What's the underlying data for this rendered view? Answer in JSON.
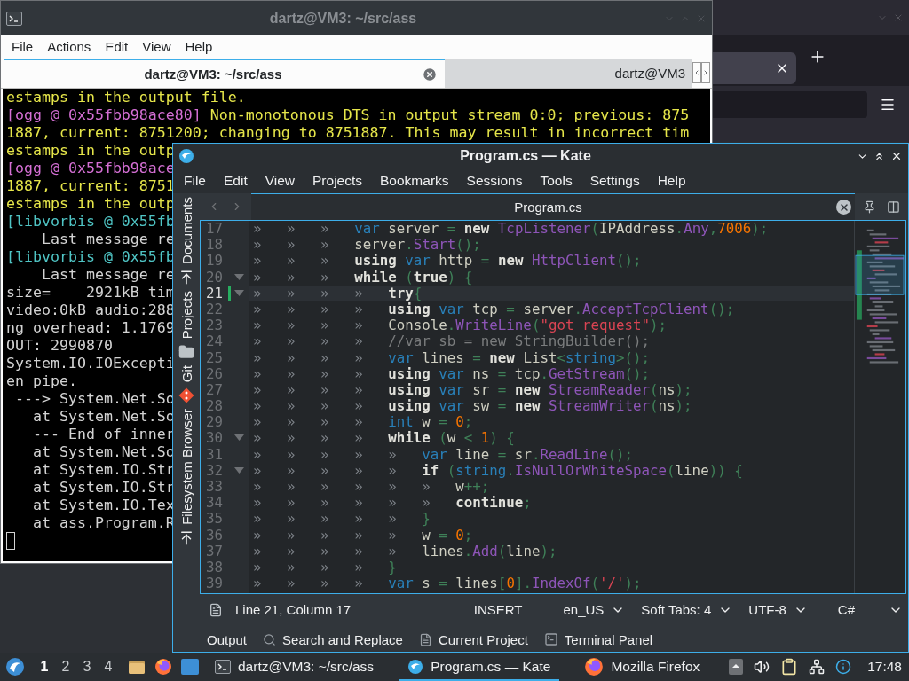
{
  "terminal": {
    "title": "dartz@VM3: ~/src/ass",
    "menu": [
      "File",
      "Actions",
      "Edit",
      "View",
      "Help"
    ],
    "tabs": [
      {
        "label": "dartz@VM3: ~/src/ass",
        "selected": true
      },
      {
        "label": "dartz@VM3",
        "selected": false
      }
    ],
    "lines": [
      {
        "segments": [
          {
            "text": "estamps in the output file.",
            "color": "#e6e64a"
          }
        ]
      },
      {
        "segments": [
          {
            "text": "[ogg @ 0x55fbb98ace80]",
            "color": "#d46fd4"
          },
          {
            "text": " Non-monotonous DTS in output stream 0:0; previous: 875",
            "color": "#e6e64a"
          }
        ]
      },
      {
        "segments": [
          {
            "text": "1887, current: 8751200; changing to 8751887. This may result in incorrect tim",
            "color": "#e6e64a"
          }
        ]
      },
      {
        "segments": [
          {
            "text": "estamps in the outp",
            "color": "#e6e64a"
          }
        ]
      },
      {
        "segments": [
          {
            "text": "[ogg @ 0x55fbb98ace",
            "color": "#d46fd4"
          }
        ]
      },
      {
        "segments": [
          {
            "text": "1887, current: 8751",
            "color": "#e6e64a"
          }
        ]
      },
      {
        "segments": [
          {
            "text": "estamps in the outp",
            "color": "#e6e64a"
          }
        ]
      },
      {
        "segments": [
          {
            "text": "[libvorbis @ 0x55fb",
            "color": "#4fc4c4"
          }
        ]
      },
      {
        "segments": [
          {
            "text": "    Last message re",
            "color": "#d3d3d3"
          }
        ]
      },
      {
        "segments": [
          {
            "text": "[libvorbis @ 0x55fb",
            "color": "#4fc4c4"
          }
        ]
      },
      {
        "segments": [
          {
            "text": "    Last message re",
            "color": "#d3d3d3"
          }
        ]
      },
      {
        "segments": [
          {
            "text": "size=    2921kB tim",
            "color": "#d3d3d3"
          }
        ]
      },
      {
        "segments": [
          {
            "text": "video:0kB audio:288",
            "color": "#d3d3d3"
          }
        ]
      },
      {
        "segments": [
          {
            "text": "ng overhead: 1.1769",
            "color": "#d3d3d3"
          }
        ]
      },
      {
        "segments": [
          {
            "text": "OUT: 2990870",
            "color": "#d3d3d3"
          }
        ]
      },
      {
        "segments": [
          {
            "text": "System.IO.IOExcepti",
            "color": "#d3d3d3"
          }
        ]
      },
      {
        "segments": [
          {
            "text": "en pipe.",
            "color": "#d3d3d3"
          }
        ]
      },
      {
        "segments": [
          {
            "text": " ---> System.Net.So",
            "color": "#d3d3d3"
          }
        ]
      },
      {
        "segments": [
          {
            "text": "   at System.Net.So",
            "color": "#d3d3d3"
          }
        ]
      },
      {
        "segments": [
          {
            "text": "   --- End of inner",
            "color": "#d3d3d3"
          }
        ]
      },
      {
        "segments": [
          {
            "text": "   at System.Net.So",
            "color": "#d3d3d3"
          }
        ]
      },
      {
        "segments": [
          {
            "text": "   at System.IO.Str",
            "color": "#d3d3d3"
          }
        ]
      },
      {
        "segments": [
          {
            "text": "   at System.IO.Str",
            "color": "#d3d3d3"
          }
        ]
      },
      {
        "segments": [
          {
            "text": "   at System.IO.Tex",
            "color": "#d3d3d3"
          }
        ]
      },
      {
        "segments": [
          {
            "text": "   at ass.Program.R",
            "color": "#d3d3d3"
          }
        ]
      }
    ]
  },
  "kate": {
    "title": "Program.cs — Kate",
    "menu": [
      "File",
      "Edit",
      "View",
      "Projects",
      "Bookmarks",
      "Sessions",
      "Tools",
      "Settings",
      "Help"
    ],
    "sidebar": [
      {
        "label": "Documents",
        "kind": "documents"
      },
      {
        "label": "Projects",
        "kind": "projects"
      },
      {
        "label": "Git",
        "kind": "git"
      },
      {
        "label": "Filesystem Browser",
        "kind": "files"
      }
    ],
    "tab": {
      "label": "Program.cs"
    },
    "editor": {
      "lines": [
        {
          "number": "17",
          "indent": "»»»",
          "fold": false,
          "modified": false,
          "current": false,
          "tokens": [
            {
              "kind": "type",
              "text": "var"
            },
            {
              "kind": "plain",
              "text": " server "
            },
            {
              "kind": "operator",
              "text": "= "
            },
            {
              "kind": "keyword",
              "text": "new "
            },
            {
              "kind": "function",
              "text": "TcpListener"
            },
            {
              "kind": "operator",
              "text": "("
            },
            {
              "kind": "plain",
              "text": "IPAddress"
            },
            {
              "kind": "operator",
              "text": "."
            },
            {
              "kind": "function",
              "text": "Any"
            },
            {
              "kind": "operator",
              "text": ","
            },
            {
              "kind": "number",
              "text": "7006"
            },
            {
              "kind": "operator",
              "text": ");"
            }
          ]
        },
        {
          "number": "18",
          "indent": "»»»",
          "fold": false,
          "modified": false,
          "current": false,
          "tokens": [
            {
              "kind": "plain",
              "text": "server"
            },
            {
              "kind": "operator",
              "text": "."
            },
            {
              "kind": "function",
              "text": "Start"
            },
            {
              "kind": "operator",
              "text": "();"
            }
          ]
        },
        {
          "number": "19",
          "indent": "»»»",
          "fold": false,
          "modified": false,
          "current": false,
          "tokens": [
            {
              "kind": "keyword",
              "text": "using "
            },
            {
              "kind": "type",
              "text": "var"
            },
            {
              "kind": "plain",
              "text": " http "
            },
            {
              "kind": "operator",
              "text": "= "
            },
            {
              "kind": "keyword",
              "text": "new "
            },
            {
              "kind": "function",
              "text": "HttpClient"
            },
            {
              "kind": "operator",
              "text": "();"
            }
          ]
        },
        {
          "number": "20",
          "indent": "»»»",
          "fold": true,
          "modified": false,
          "current": false,
          "tokens": [
            {
              "kind": "keyword",
              "text": "while "
            },
            {
              "kind": "operator",
              "text": "("
            },
            {
              "kind": "keyword",
              "text": "true"
            },
            {
              "kind": "operator",
              "text": ") {"
            }
          ]
        },
        {
          "number": "21",
          "indent": "»»»»",
          "fold": true,
          "modified": true,
          "current": true,
          "tokens": [
            {
              "kind": "keyword",
              "text": "try"
            },
            {
              "kind": "operator",
              "text": "{"
            }
          ]
        },
        {
          "number": "22",
          "indent": "»»»»",
          "fold": false,
          "modified": false,
          "current": false,
          "tokens": [
            {
              "kind": "keyword",
              "text": "using "
            },
            {
              "kind": "type",
              "text": "var"
            },
            {
              "kind": "plain",
              "text": " tcp "
            },
            {
              "kind": "operator",
              "text": "="
            },
            {
              "kind": "plain",
              "text": " server"
            },
            {
              "kind": "operator",
              "text": "."
            },
            {
              "kind": "function",
              "text": "AcceptTcpClient"
            },
            {
              "kind": "operator",
              "text": "();"
            }
          ]
        },
        {
          "number": "23",
          "indent": "»»»»",
          "fold": false,
          "modified": false,
          "current": false,
          "tokens": [
            {
              "kind": "plain",
              "text": "Console"
            },
            {
              "kind": "operator",
              "text": "."
            },
            {
              "kind": "function",
              "text": "WriteLine"
            },
            {
              "kind": "operator",
              "text": "("
            },
            {
              "kind": "string",
              "text": "\"got request\""
            },
            {
              "kind": "operator",
              "text": ");"
            }
          ]
        },
        {
          "number": "24",
          "indent": "»»»»",
          "fold": false,
          "modified": false,
          "current": false,
          "tokens": [
            {
              "kind": "comment",
              "text": "//var sb = new StringBuilder();"
            }
          ]
        },
        {
          "number": "25",
          "indent": "»»»»",
          "fold": false,
          "modified": false,
          "current": false,
          "tokens": [
            {
              "kind": "type",
              "text": "var"
            },
            {
              "kind": "plain",
              "text": " lines "
            },
            {
              "kind": "operator",
              "text": "= "
            },
            {
              "kind": "keyword",
              "text": "new"
            },
            {
              "kind": "plain",
              "text": " List"
            },
            {
              "kind": "operator",
              "text": "<"
            },
            {
              "kind": "type",
              "text": "string"
            },
            {
              "kind": "operator",
              "text": ">();"
            }
          ]
        },
        {
          "number": "26",
          "indent": "»»»»",
          "fold": false,
          "modified": false,
          "current": false,
          "tokens": [
            {
              "kind": "keyword",
              "text": "using "
            },
            {
              "kind": "type",
              "text": "var"
            },
            {
              "kind": "plain",
              "text": " ns "
            },
            {
              "kind": "operator",
              "text": "="
            },
            {
              "kind": "plain",
              "text": " tcp"
            },
            {
              "kind": "operator",
              "text": "."
            },
            {
              "kind": "function",
              "text": "GetStream"
            },
            {
              "kind": "operator",
              "text": "();"
            }
          ]
        },
        {
          "number": "27",
          "indent": "»»»»",
          "fold": false,
          "modified": false,
          "current": false,
          "tokens": [
            {
              "kind": "keyword",
              "text": "using "
            },
            {
              "kind": "type",
              "text": "var"
            },
            {
              "kind": "plain",
              "text": " sr "
            },
            {
              "kind": "operator",
              "text": "= "
            },
            {
              "kind": "keyword",
              "text": "new "
            },
            {
              "kind": "function",
              "text": "StreamReader"
            },
            {
              "kind": "operator",
              "text": "("
            },
            {
              "kind": "plain",
              "text": "ns"
            },
            {
              "kind": "operator",
              "text": ");"
            }
          ]
        },
        {
          "number": "28",
          "indent": "»»»»",
          "fold": false,
          "modified": false,
          "current": false,
          "tokens": [
            {
              "kind": "keyword",
              "text": "using "
            },
            {
              "kind": "type",
              "text": "var"
            },
            {
              "kind": "plain",
              "text": " sw "
            },
            {
              "kind": "operator",
              "text": "= "
            },
            {
              "kind": "keyword",
              "text": "new "
            },
            {
              "kind": "function",
              "text": "StreamWriter"
            },
            {
              "kind": "operator",
              "text": "("
            },
            {
              "kind": "plain",
              "text": "ns"
            },
            {
              "kind": "operator",
              "text": ");"
            }
          ]
        },
        {
          "number": "29",
          "indent": "»»»»",
          "fold": false,
          "modified": false,
          "current": false,
          "tokens": [
            {
              "kind": "type",
              "text": "int"
            },
            {
              "kind": "plain",
              "text": " w "
            },
            {
              "kind": "operator",
              "text": "= "
            },
            {
              "kind": "number",
              "text": "0"
            },
            {
              "kind": "operator",
              "text": ";"
            }
          ]
        },
        {
          "number": "30",
          "indent": "»»»»",
          "fold": true,
          "modified": false,
          "current": false,
          "tokens": [
            {
              "kind": "keyword",
              "text": "while "
            },
            {
              "kind": "operator",
              "text": "("
            },
            {
              "kind": "plain",
              "text": "w "
            },
            {
              "kind": "operator",
              "text": "< "
            },
            {
              "kind": "number",
              "text": "1"
            },
            {
              "kind": "operator",
              "text": ") {"
            }
          ]
        },
        {
          "number": "31",
          "indent": "»»»»»",
          "fold": false,
          "modified": false,
          "current": false,
          "tokens": [
            {
              "kind": "type",
              "text": "var"
            },
            {
              "kind": "plain",
              "text": " line "
            },
            {
              "kind": "operator",
              "text": "="
            },
            {
              "kind": "plain",
              "text": " sr"
            },
            {
              "kind": "operator",
              "text": "."
            },
            {
              "kind": "function",
              "text": "ReadLine"
            },
            {
              "kind": "operator",
              "text": "();"
            }
          ]
        },
        {
          "number": "32",
          "indent": "»»»»»",
          "fold": true,
          "modified": false,
          "current": false,
          "tokens": [
            {
              "kind": "keyword",
              "text": "if "
            },
            {
              "kind": "operator",
              "text": "("
            },
            {
              "kind": "type",
              "text": "string"
            },
            {
              "kind": "operator",
              "text": "."
            },
            {
              "kind": "function",
              "text": "IsNullOrWhiteSpace"
            },
            {
              "kind": "operator",
              "text": "("
            },
            {
              "kind": "plain",
              "text": "line"
            },
            {
              "kind": "operator",
              "text": ")) {"
            }
          ]
        },
        {
          "number": "33",
          "indent": "»»»»»»",
          "fold": false,
          "modified": false,
          "current": false,
          "tokens": [
            {
              "kind": "plain",
              "text": "w"
            },
            {
              "kind": "operator",
              "text": "++;"
            }
          ]
        },
        {
          "number": "34",
          "indent": "»»»»»»",
          "fold": false,
          "modified": false,
          "current": false,
          "tokens": [
            {
              "kind": "keyword",
              "text": "continue"
            },
            {
              "kind": "operator",
              "text": ";"
            }
          ]
        },
        {
          "number": "35",
          "indent": "»»»»»",
          "fold": false,
          "modified": false,
          "current": false,
          "tokens": [
            {
              "kind": "operator",
              "text": "}"
            }
          ]
        },
        {
          "number": "36",
          "indent": "»»»»»",
          "fold": false,
          "modified": false,
          "current": false,
          "tokens": [
            {
              "kind": "plain",
              "text": "w "
            },
            {
              "kind": "operator",
              "text": "= "
            },
            {
              "kind": "number",
              "text": "0"
            },
            {
              "kind": "operator",
              "text": ";"
            }
          ]
        },
        {
          "number": "37",
          "indent": "»»»»»",
          "fold": false,
          "modified": false,
          "current": false,
          "tokens": [
            {
              "kind": "plain",
              "text": "lines"
            },
            {
              "kind": "operator",
              "text": "."
            },
            {
              "kind": "function",
              "text": "Add"
            },
            {
              "kind": "operator",
              "text": "("
            },
            {
              "kind": "plain",
              "text": "line"
            },
            {
              "kind": "operator",
              "text": ");"
            }
          ]
        },
        {
          "number": "38",
          "indent": "»»»»",
          "fold": false,
          "modified": false,
          "current": false,
          "tokens": [
            {
              "kind": "operator",
              "text": "}"
            }
          ]
        },
        {
          "number": "39",
          "indent": "»»»»",
          "fold": false,
          "modified": false,
          "current": false,
          "tokens": [
            {
              "kind": "type",
              "text": "var"
            },
            {
              "kind": "plain",
              "text": " s "
            },
            {
              "kind": "operator",
              "text": "="
            },
            {
              "kind": "plain",
              "text": " lines"
            },
            {
              "kind": "operator",
              "text": "["
            },
            {
              "kind": "number",
              "text": "0"
            },
            {
              "kind": "operator",
              "text": "]."
            },
            {
              "kind": "function",
              "text": "IndexOf"
            },
            {
              "kind": "operator",
              "text": "("
            },
            {
              "kind": "string",
              "text": "'/'"
            },
            {
              "kind": "operator",
              "text": ");"
            }
          ]
        }
      ]
    },
    "status": {
      "position": "Line 21, Column 17",
      "mode": "INSERT",
      "dictionary": "en_US",
      "indentation": "Soft Tabs: 4",
      "encoding": "UTF-8",
      "syntax": "C#"
    },
    "panels": [
      {
        "label": "Output",
        "kind": "output"
      },
      {
        "label": "Search and Replace",
        "kind": "search"
      },
      {
        "label": "Current Project",
        "kind": "project"
      },
      {
        "label": "Terminal Panel",
        "kind": "terminal"
      }
    ]
  },
  "taskbar": {
    "workspaces": [
      {
        "label": "1",
        "selected": true
      },
      {
        "label": "2",
        "selected": false
      },
      {
        "label": "3",
        "selected": false
      },
      {
        "label": "4",
        "selected": false
      }
    ],
    "tasks": [
      {
        "label": "dartz@VM3: ~/src/ass",
        "kind": "terminal",
        "selected": false
      },
      {
        "label": "Program.cs — Kate",
        "kind": "editor",
        "selected": true
      },
      {
        "label": "Mozilla Firefox",
        "kind": "browser",
        "selected": false
      }
    ],
    "clock": "17:48"
  }
}
